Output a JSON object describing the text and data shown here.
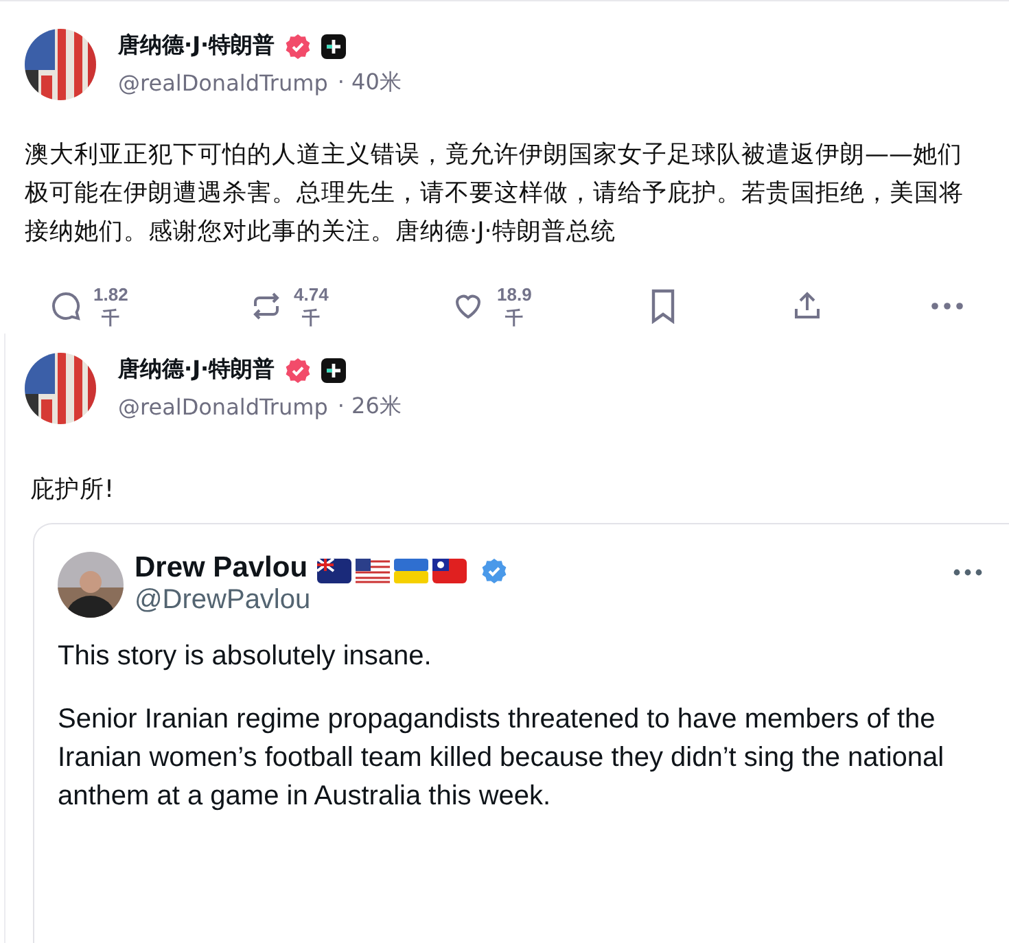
{
  "posts": [
    {
      "author": "唐纳德·J·特朗普",
      "verified": true,
      "handle": "@realDonaldTrump",
      "time": "· 40米",
      "body": "澳大利亚正犯下可怕的人道主义错误，竟允许伊朗国家女子足球队被遣返伊朗——她们极可能在伊朗遭遇杀害。总理先生，请不要这样做，请给予庇护。若贵国拒绝，美国将接纳她们。感谢您对此事的关注。唐纳德·J·特朗普总统",
      "actions": [
        {
          "kind": "reply",
          "count": "1.82",
          "unit": "千"
        },
        {
          "kind": "repost",
          "count": "4.74",
          "unit": "千"
        },
        {
          "kind": "like",
          "count": "18.9",
          "unit": "千"
        },
        {
          "kind": "bookmark"
        },
        {
          "kind": "share"
        },
        {
          "kind": "more"
        }
      ]
    },
    {
      "author": "唐纳德·J·特朗普",
      "verified": true,
      "handle": "@realDonaldTrump",
      "time": "· 26米",
      "body": "庇护所!",
      "quote": {
        "author": "Drew Pavlou",
        "verified": true,
        "handle": "@DrewPavlou",
        "paragraphs": [
          "This story is absolutely insane.",
          "Senior Iranian regime propagandists threatened to have members of the Iranian women’s football team killed because they didn’t sing the national anthem at a game in Australia this week."
        ]
      }
    }
  ]
}
